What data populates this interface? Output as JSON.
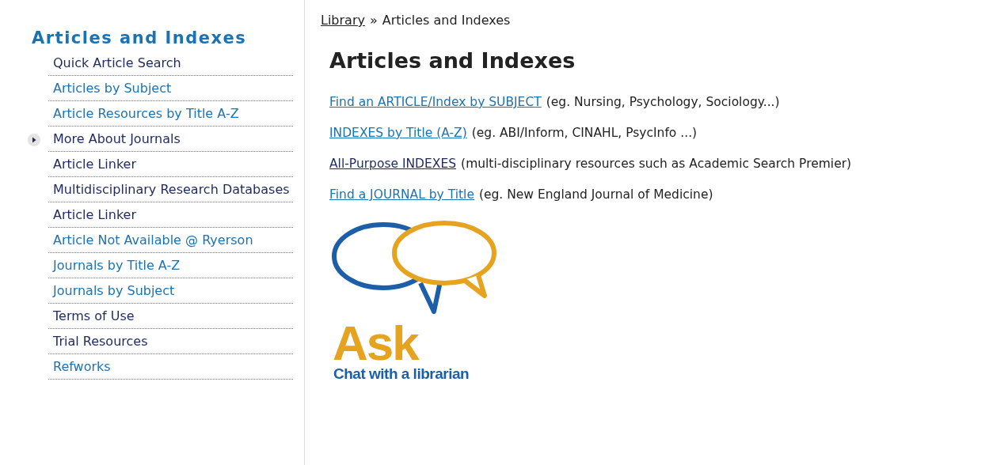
{
  "sidebar": {
    "title": "Articles and Indexes",
    "items": [
      {
        "label": "Quick Article Search",
        "visited": true,
        "expandable": false
      },
      {
        "label": "Articles by Subject",
        "visited": false,
        "expandable": false
      },
      {
        "label": "Article Resources by Title A-Z",
        "visited": false,
        "expandable": false
      },
      {
        "label": "More About Journals",
        "visited": true,
        "expandable": true
      },
      {
        "label": "Article Linker",
        "visited": true,
        "expandable": false
      },
      {
        "label": "Multidisciplinary Research Databases",
        "visited": true,
        "expandable": false
      },
      {
        "label": "Article Linker",
        "visited": true,
        "expandable": false
      },
      {
        "label": "Article Not Available @ Ryerson",
        "visited": false,
        "expandable": false
      },
      {
        "label": "Journals by Title A-Z",
        "visited": false,
        "expandable": false
      },
      {
        "label": "Journals by Subject",
        "visited": false,
        "expandable": false
      },
      {
        "label": "Terms of Use",
        "visited": true,
        "expandable": false
      },
      {
        "label": "Trial Resources",
        "visited": true,
        "expandable": false
      },
      {
        "label": "Refworks",
        "visited": false,
        "expandable": false
      }
    ]
  },
  "breadcrumb": {
    "link": "Library",
    "separator": "»",
    "current": "Articles and Indexes"
  },
  "heading": "Articles and Indexes",
  "links": [
    {
      "link": "Find an ARTICLE/Index by SUBJECT",
      "note": "(eg. Nursing, Psychology, Sociology...)",
      "visited": false
    },
    {
      "link": "INDEXES by Title (A-Z)",
      "note": "(eg. ABI/Inform, CINAHL, PsycInfo ...)",
      "visited": false
    },
    {
      "link": "All-Purpose INDEXES",
      "note": "(multi-disciplinary resources such as Academic Search Premier)",
      "visited": true
    },
    {
      "link": "Find a JOURNAL by Title",
      "note": "(eg. New England Journal of Medicine)",
      "visited": false
    }
  ],
  "ask_logo": {
    "word": "Ask",
    "tagline": "Chat with a librarian"
  }
}
